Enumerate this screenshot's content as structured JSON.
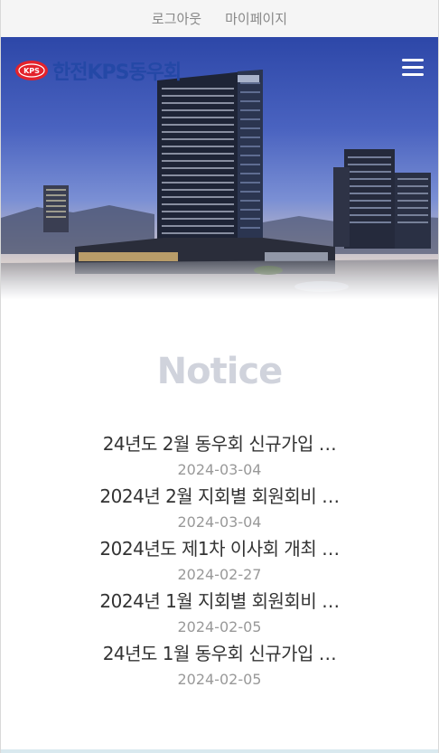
{
  "topbar": {
    "logout_label": "로그아웃",
    "mypage_label": "마이페이지"
  },
  "header": {
    "logo_mark_text": "KPS",
    "logo_text": "한전KPS동우회",
    "menu_icon": "hamburger-icon"
  },
  "notice": {
    "title": "Notice",
    "items": [
      {
        "title": "24년도 2월 동우회 신규가입 …",
        "date": "2024-03-04"
      },
      {
        "title": "2024년 2월 지회별 회원회비 …",
        "date": "2024-03-04"
      },
      {
        "title": "2024년도 제1차 이사회 개최 …",
        "date": "2024-02-27"
      },
      {
        "title": "2024년 1월 지회별 회원회비 …",
        "date": "2024-02-05"
      },
      {
        "title": "24년도 1월 동우회 신규가입 …",
        "date": "2024-02-05"
      }
    ]
  },
  "colors": {
    "logo_blue": "#2448a6",
    "logo_red": "#e3222b",
    "notice_title": "#d0d3dc",
    "date_gray": "#999999"
  }
}
